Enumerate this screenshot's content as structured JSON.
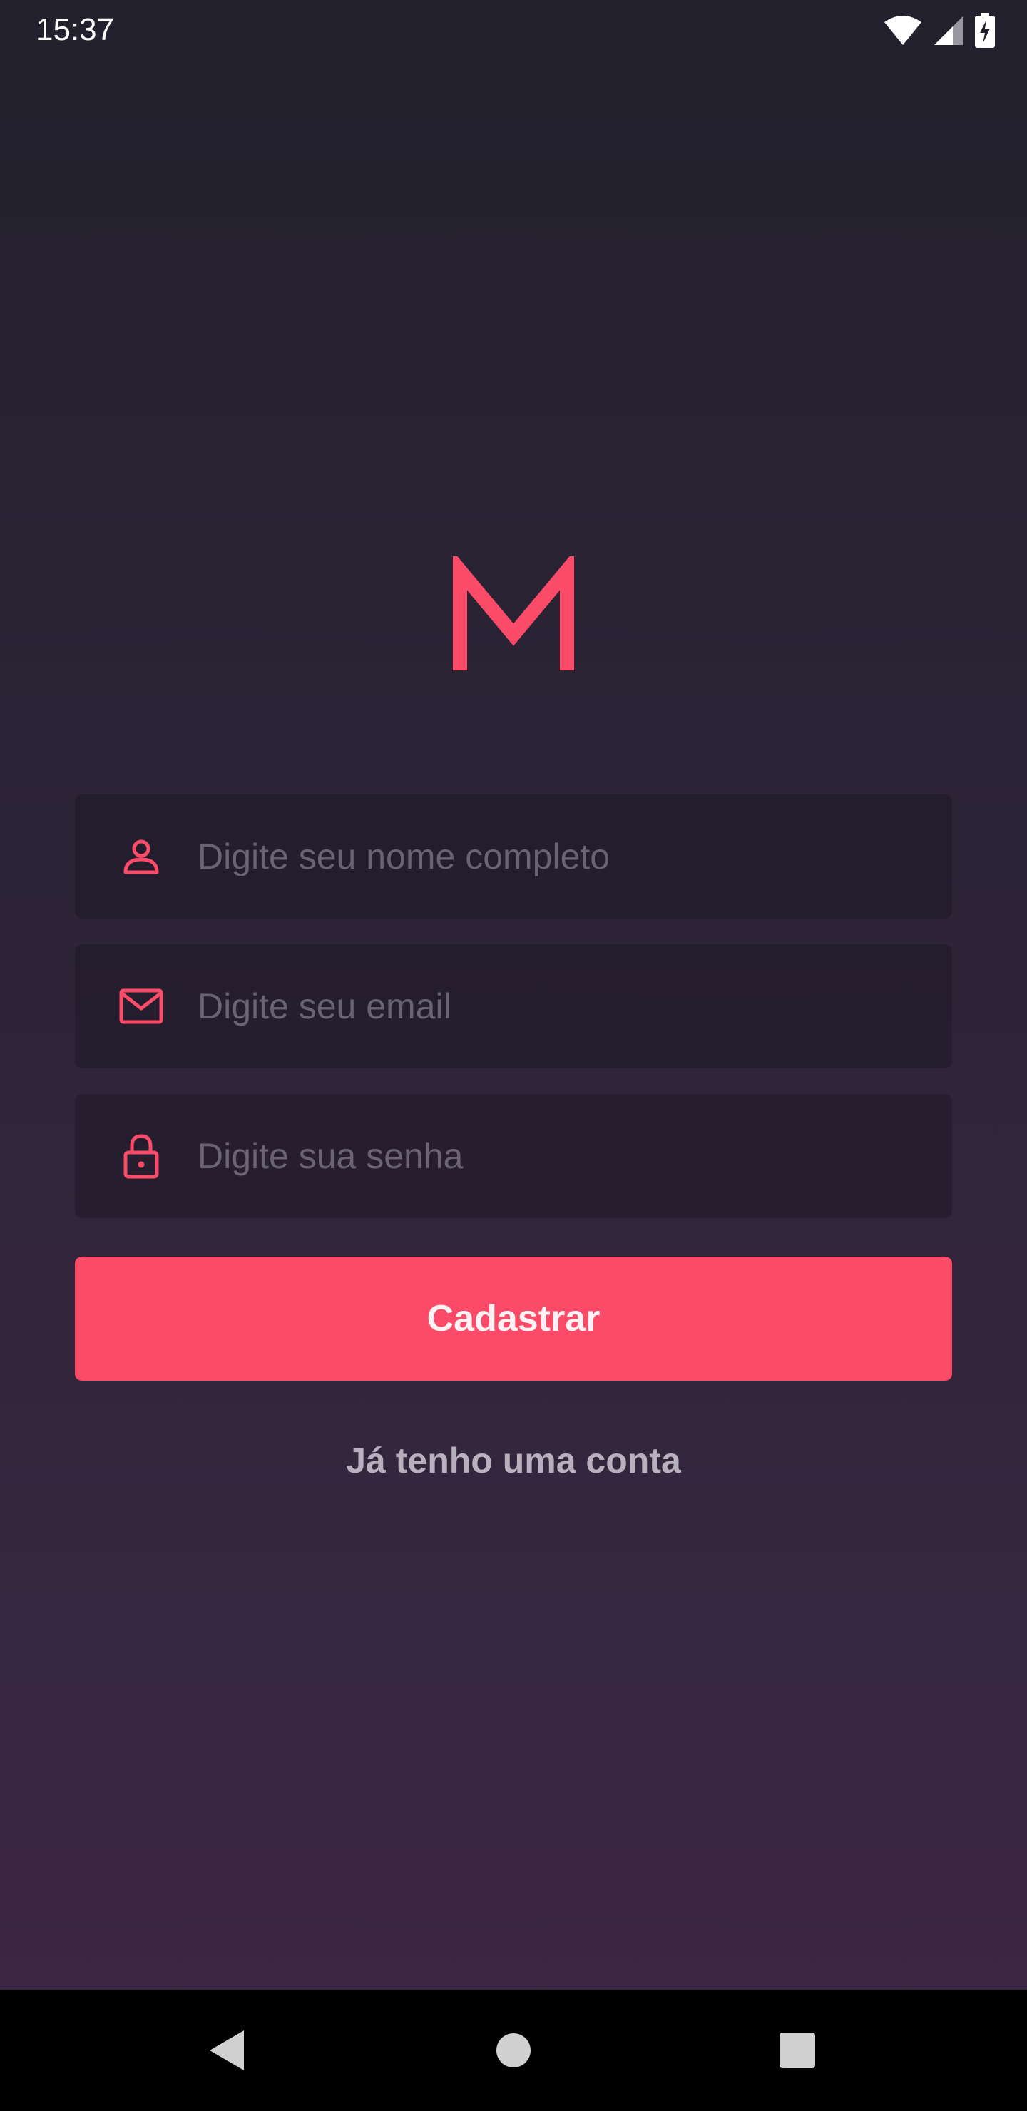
{
  "status_bar": {
    "time": "15:37",
    "icons": [
      "wifi-icon",
      "cellular-signal-icon",
      "battery-charging-icon"
    ]
  },
  "logo": {
    "letter": "M",
    "color": "#fb4b68"
  },
  "form": {
    "name_field": {
      "placeholder": "Digite seu nome completo",
      "value": "",
      "icon": "user-icon"
    },
    "email_field": {
      "placeholder": "Digite seu email",
      "value": "",
      "icon": "mail-icon"
    },
    "password_field": {
      "placeholder": "Digite sua senha",
      "value": "",
      "icon": "lock-icon"
    },
    "submit_label": "Cadastrar",
    "login_link": "Já tenho uma conta"
  },
  "nav_bar": {
    "buttons": [
      "back-icon",
      "home-icon",
      "recents-icon"
    ]
  },
  "colors": {
    "accent": "#fb4b68",
    "background_top": "#23212e",
    "background_bottom": "#3d2744"
  }
}
